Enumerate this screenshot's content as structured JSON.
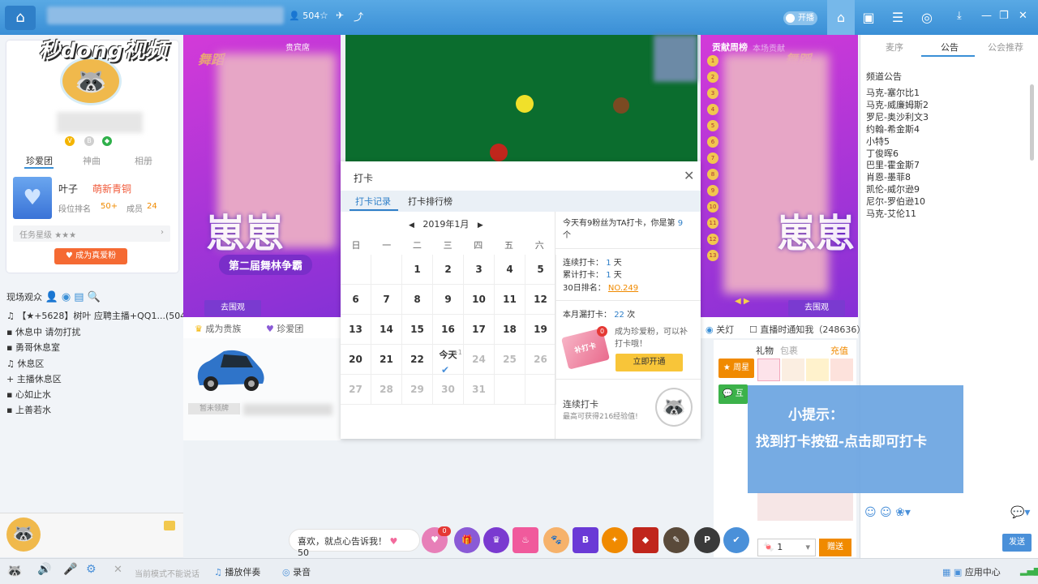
{
  "topbar": {
    "viewers": "504",
    "live_toggle": "开播"
  },
  "watermark": "秒dong视频",
  "profile": {
    "tabs": [
      "珍爱团",
      "神曲",
      "相册"
    ],
    "fan_name": "叶子",
    "fan_level": "萌新青铜",
    "rank_label": "段位排名",
    "rank_value": "50+",
    "member_label": "成员",
    "member_value": "24",
    "task_label": "任务星级",
    "fan_button": "成为真爱粉"
  },
  "scene": {
    "header": "现场观众",
    "items": [
      "【★+5628】树叶 应聘主播+QQ1...(504)",
      "休息中 请勿打扰",
      "勇哥休息室",
      "休息区",
      "主播休息区",
      "心如止水",
      "上善若水"
    ]
  },
  "banners": {
    "left_tag": "贵宾席",
    "right_tag": "贡献周榜",
    "right_tag_sub": "本场贡献",
    "title": "崽崽",
    "subtitle": "第二届舞林争霸",
    "go_button": "去围观",
    "stage_label": "舞蹈"
  },
  "left_actions": {
    "noble": "成为贵族",
    "fans": "珍爱团",
    "car_label": "暂未领牌"
  },
  "right_actions": {
    "light": "关灯",
    "notify": "直播时通知我（248636）",
    "gift_tab": "礼物",
    "bag_tab": "包裹",
    "recharge": "充值",
    "send": "赠送",
    "qty": "1"
  },
  "checkin": {
    "title": "打卡",
    "tabs": [
      "打卡记录",
      "打卡排行榜"
    ],
    "month": "2019年1月",
    "dow": [
      "日",
      "一",
      "二",
      "三",
      "四",
      "五",
      "六"
    ],
    "days": [
      "",
      "",
      "1",
      "2",
      "3",
      "4",
      "5",
      "6",
      "7",
      "8",
      "9",
      "10",
      "11",
      "12",
      "13",
      "14",
      "15",
      "16",
      "17",
      "18",
      "19",
      "20",
      "21",
      "22",
      "今天",
      "24",
      "25",
      "26",
      "27",
      "28",
      "29",
      "30",
      "31",
      "",
      ""
    ],
    "today_text_pre": "今天有9粉丝为TA打卡，你是第",
    "today_rank": "9",
    "today_text_post": "个",
    "streak_label": "连续打卡：",
    "streak_value": "1",
    "total_label": "累计打卡：",
    "total_value": "1",
    "rank30_label": "30日排名：",
    "rank30_value": "NO.249",
    "missed_label": "本月漏打卡：",
    "missed_value": "22",
    "unit_day": "天",
    "unit_times": "次",
    "fan_hint_1": "成为珍爱粉，可以补",
    "fan_hint_2": "打卡哦！",
    "open_button": "立即开通",
    "card_text": "补打卡",
    "card_badge": "0",
    "streak_title": "连续打卡",
    "streak_reward": "最高可获得216经验值!",
    "today_plus": "+1"
  },
  "hint": {
    "title": "小提示：",
    "body": "找到打卡按钮-点击即可打卡"
  },
  "chat": {
    "tabs": [
      "麦序",
      "公告",
      "公会推荐"
    ],
    "notice_title": "频道公告",
    "notices": [
      "马克-塞尔比1",
      "马克-威廉姆斯2",
      "罗尼-奥沙利文3",
      "约翰-希金斯4",
      "小特5",
      "丁俊晖6",
      "巴里-霍金斯7",
      "肖恩-墨菲8",
      "凯伦-威尔逊9",
      "尼尔-罗伯逊10",
      "马克-艾伦11"
    ],
    "send": "发送"
  },
  "giftbar": {
    "placeholder": "喜欢，就点心告诉我！",
    "count": "50",
    "badge": "0"
  },
  "bottombar": {
    "mode_text": "当前模式不能说话",
    "accompany": "播放伴奏",
    "record": "录音",
    "app_center": "应用中心"
  }
}
